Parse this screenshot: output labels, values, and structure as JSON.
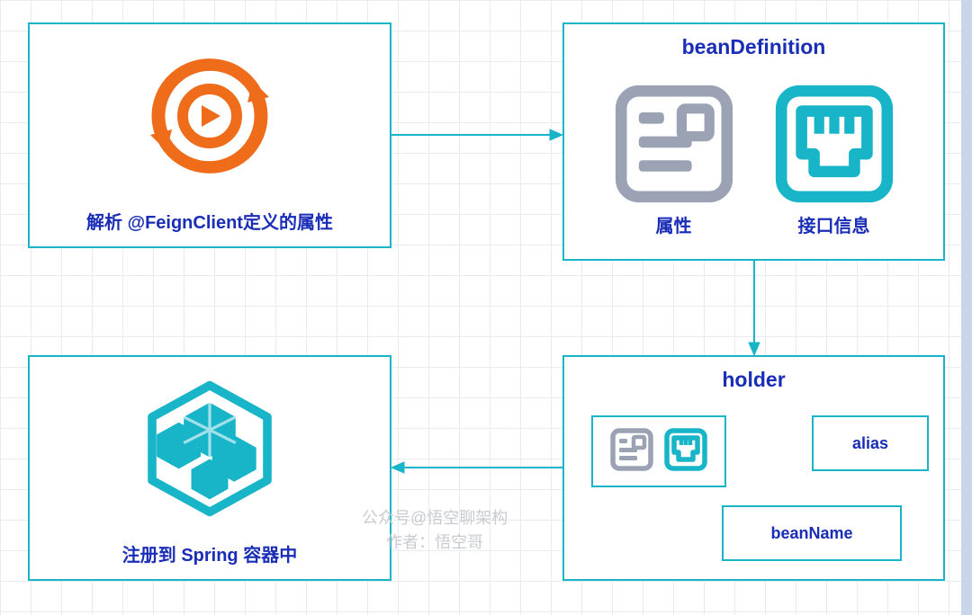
{
  "boxes": {
    "leftTop": {
      "caption": "解析 @FeignClient定义的属性"
    },
    "leftBottom": {
      "caption": "注册到 Spring 容器中"
    },
    "rightTop": {
      "title": "beanDefinition",
      "labelLeft": "属性",
      "labelRight": "接口信息"
    },
    "rightBottom": {
      "title": "holder",
      "alias": "alias",
      "beanName": "beanName"
    }
  },
  "watermark": {
    "line1": "公众号@悟空聊架构",
    "line2": "作者：悟空哥"
  }
}
